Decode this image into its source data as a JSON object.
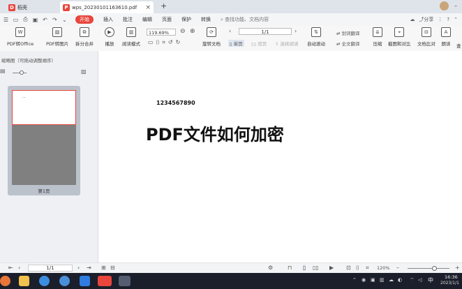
{
  "tabs": [
    {
      "label": "稻壳",
      "active": false
    },
    {
      "label": "wps_20230101163610.pdf",
      "active": true
    }
  ],
  "new_tab": "+",
  "window": {
    "share": "分享"
  },
  "menu": {
    "items": [
      "开始",
      "插入",
      "批注",
      "编辑",
      "页面",
      "保护",
      "转换"
    ],
    "search": "查找功能、文档内容"
  },
  "toolbar": {
    "pdf_to_office": "PDF转Office",
    "pdf_to_image": "PDF转图片",
    "split_merge": "拆分合并",
    "play": "播放",
    "read_mode": "阅读模式",
    "zoom": "119.69%",
    "page": "1/1",
    "rotate": "旋转文档",
    "single_page": "单页",
    "double_page": "双页",
    "continuous": "连续阅读",
    "auto_scroll": "自动滚动",
    "translate": "划词翻译",
    "full_translate": "全文翻译",
    "compress": "压缩",
    "screenshot_compare": "截图和对比",
    "doc_compare": "文档比对",
    "read_aloud": "朗读",
    "more": "查"
  },
  "leftpanel": {
    "title": "缩略图（可拖动调整顺序）",
    "thumb_label": "第1页",
    "thumb_text": "..."
  },
  "document": {
    "number": "1234567890",
    "heading": "PDF文件如何加密"
  },
  "status": {
    "page": "1/1",
    "zoom": "120%"
  },
  "tray": {
    "time": "16:36",
    "date": "2023/1/1",
    "lang": "中"
  },
  "colors": {
    "accent": "#e8453c",
    "taskbar": "#1b1f2b"
  }
}
